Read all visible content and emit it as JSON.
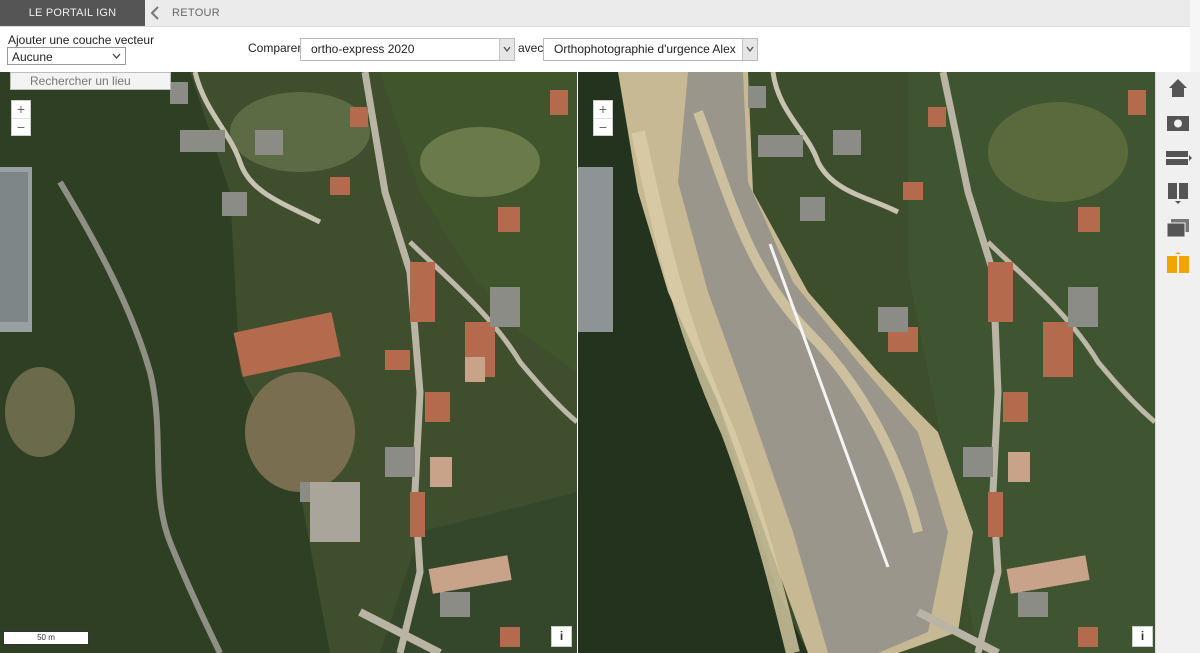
{
  "header": {
    "portal_label": "LE PORTAIL IGN",
    "back_label": "RETOUR"
  },
  "controls": {
    "vector_layer_label": "Ajouter une couche vecteur",
    "vector_layer_value": "Aucune",
    "compare_label": "Comparer",
    "compare_left_value": "ortho-express 2020",
    "with_label": "avec",
    "compare_right_value": "Orthophotographie d'urgence Alex"
  },
  "map": {
    "search_placeholder": "Rechercher un lieu",
    "zoom_in": "+",
    "zoom_out": "−",
    "scale_label": "50 m",
    "info_label": "i"
  },
  "toolbar": {
    "icons": [
      "home-icon",
      "camera-icon",
      "horizontal-split-icon",
      "vertical-split-icon",
      "layers-icon",
      "side-by-side-compare-icon"
    ],
    "active_color": "#f0a500"
  }
}
